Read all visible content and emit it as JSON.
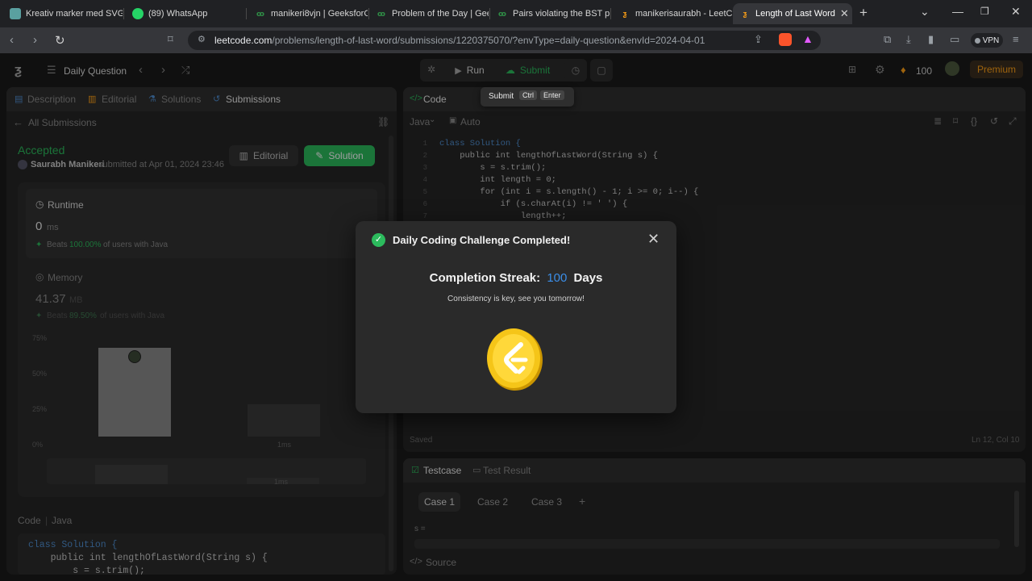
{
  "browser": {
    "tabs": [
      {
        "title": "Kreativ marker med SVG",
        "fav_color": "#5aa0a0"
      },
      {
        "title": "(89) WhatsApp",
        "fav_color": "#25d366"
      },
      {
        "title": "manikeri8vjn | GeeksforGe",
        "fav_color": "#2f8d46"
      },
      {
        "title": "Problem of the Day | Geel",
        "fav_color": "#2f8d46"
      },
      {
        "title": "Pairs violating the BST pr",
        "fav_color": "#2f8d46"
      },
      {
        "title": "manikerisaurabh - LeetCo",
        "fav_color": "#ffa116"
      },
      {
        "title": "Length of Last Word",
        "fav_color": "#ffa116"
      }
    ],
    "url_domain": "leetcode.com",
    "url_path": "/problems/length-of-last-word/submissions/1220375070/?envType=daily-question&envId=2024-04-01",
    "vpn_label": "VPN"
  },
  "header": {
    "daily_question": "Daily Question",
    "run_label": "Run",
    "submit_label": "Submit",
    "streak_count": "100",
    "premium_label": "Premium"
  },
  "tooltip": {
    "label": "Submit",
    "key1": "Ctrl",
    "key2": "Enter"
  },
  "left": {
    "tabs": [
      "Description",
      "Editorial",
      "Solutions",
      "Submissions"
    ],
    "back_label": "All Submissions",
    "status": "Accepted",
    "user": "Saurabh Manikeri",
    "submitted_text": "submitted at Apr 01, 2024 23:46",
    "editorial_btn": "Editorial",
    "solution_btn": "Solution",
    "runtime": {
      "label": "Runtime",
      "value": "0",
      "unit": "ms",
      "beats_prefix": "Beats",
      "beats_value": "100.00%",
      "beats_suffix": "of users with Java"
    },
    "memory": {
      "label": "Memory",
      "value": "41.37",
      "unit": "MB",
      "beats_prefix": "Beats",
      "beats_value": "89.50%",
      "beats_suffix": "of users with Java"
    },
    "chart_yticks": [
      "75%",
      "50%",
      "25%",
      "0%"
    ],
    "chart_xlabel": "1ms",
    "chart_xlabel2": "1ms",
    "code_label": "Code",
    "code_lang": "Java",
    "code_lines": [
      "class Solution {",
      "    public int lengthOfLastWord(String s) {",
      "        s = s.trim();"
    ]
  },
  "editor": {
    "title": "Code",
    "lang": "Java",
    "auto": "Auto",
    "lines": [
      "class Solution {",
      "    public int lengthOfLastWord(String s) {",
      "        s = s.trim();",
      "        int length = 0;",
      "        for (int i = s.length() - 1; i >= 0; i--) {",
      "            if (s.charAt(i) != ' ') {",
      "                length++;"
    ],
    "saved": "Saved",
    "cursor": "Ln 12, Col 10"
  },
  "testcase": {
    "tab1": "Testcase",
    "tab2": "Test Result",
    "cases": [
      "Case 1",
      "Case 2",
      "Case 3"
    ],
    "var_label": "s =",
    "source": "Source"
  },
  "modal": {
    "title": "Daily Coding Challenge Completed!",
    "streak_label": "Completion Streak:",
    "streak_value": "100",
    "streak_unit": "Days",
    "message": "Consistency is key, see you tomorrow!"
  },
  "colors": {
    "accent_green": "#2cbb5d",
    "accent_blue": "#3b8ee8",
    "coin_gold": "#f5c518"
  }
}
